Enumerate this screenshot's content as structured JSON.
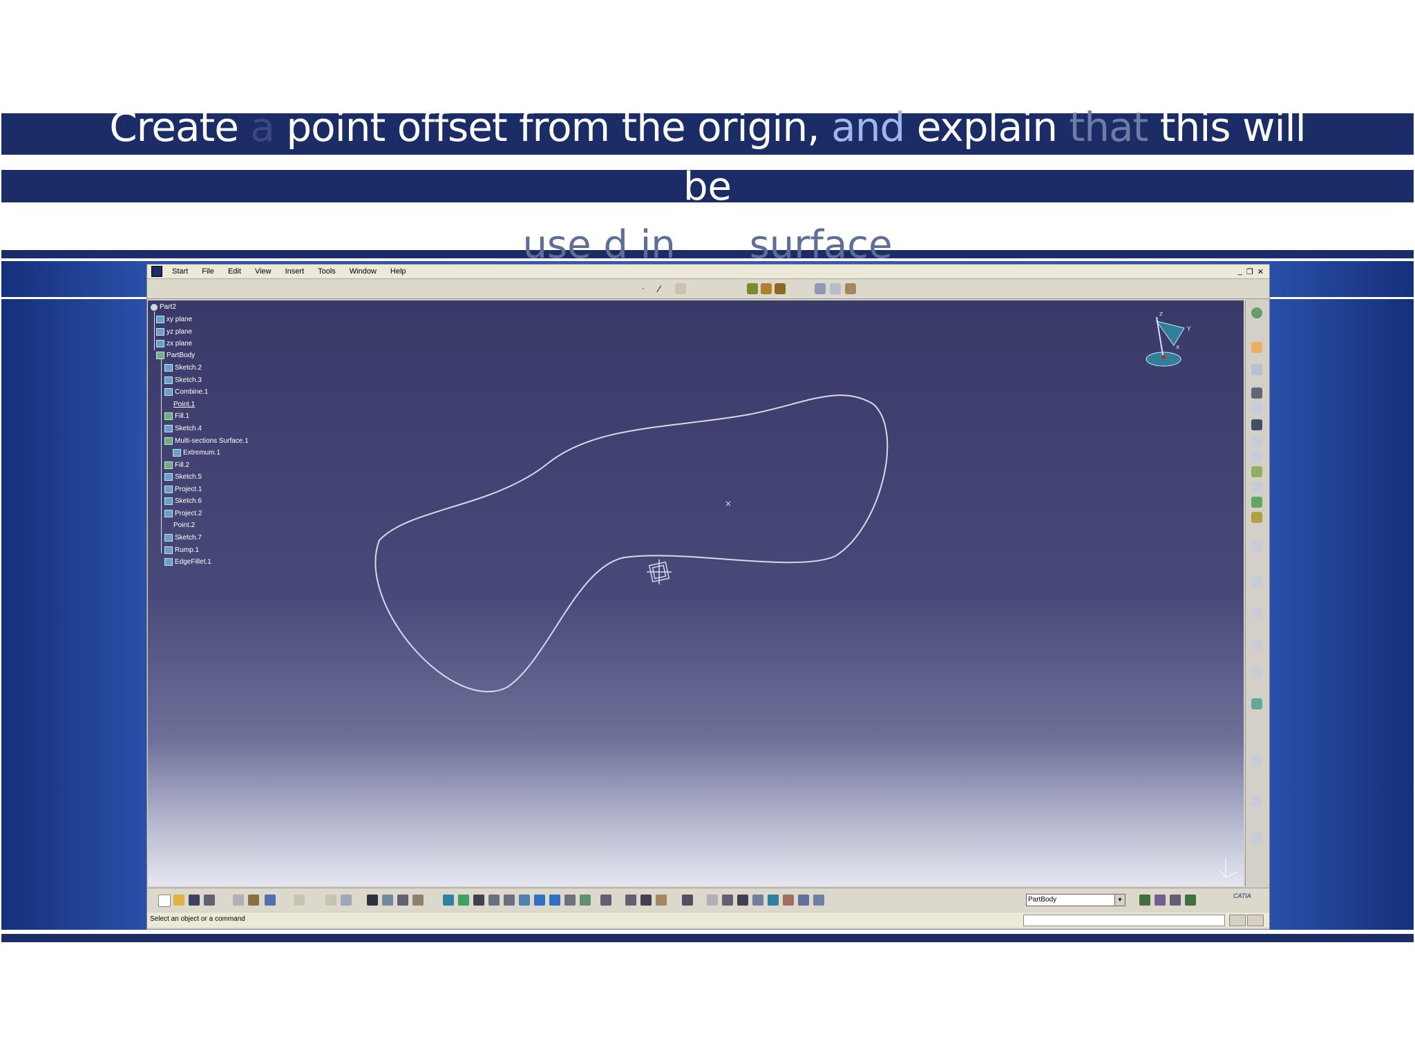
{
  "slide": {
    "title_line1": {
      "w1": "Create",
      "w2": "a",
      "w3": "point offset from the origin,",
      "w4": "and",
      "w5": "explain",
      "w6": "that",
      "w7": "this will"
    },
    "title_line2": "be",
    "title_line3": {
      "w1": "use d in",
      "w2": "surface"
    }
  },
  "catia": {
    "menu": [
      "Start",
      "File",
      "Edit",
      "View",
      "Insert",
      "Tools",
      "Window",
      "Help"
    ],
    "tree": {
      "root": "Part2",
      "items": [
        "xy plane",
        "yz plane",
        "zx plane",
        "PartBody",
        "Sketch.2",
        "Sketch.3",
        "Combine.1",
        "Point.1",
        "Fill.1",
        "Sketch.4",
        "Multi-sections Surface.1",
        "Extremum.1",
        "Fill.2",
        "Sketch.5",
        "Project.1",
        "Sketch.6",
        "Project.2",
        "Point.2",
        "Sketch.7",
        "Rump.1",
        "EdgeFillet.1"
      ]
    },
    "compass_axes": {
      "x": "x",
      "y": "Y",
      "z": "z"
    },
    "workbench_combo": "PartBody",
    "status_prompt": "Select an object or a command",
    "brand": "CATIA"
  },
  "colors": {
    "title_bar": "#1b2c66",
    "backdrop": "#2a4fa8",
    "viewport_top": "#3a3a69",
    "curve": "#d8daea"
  }
}
